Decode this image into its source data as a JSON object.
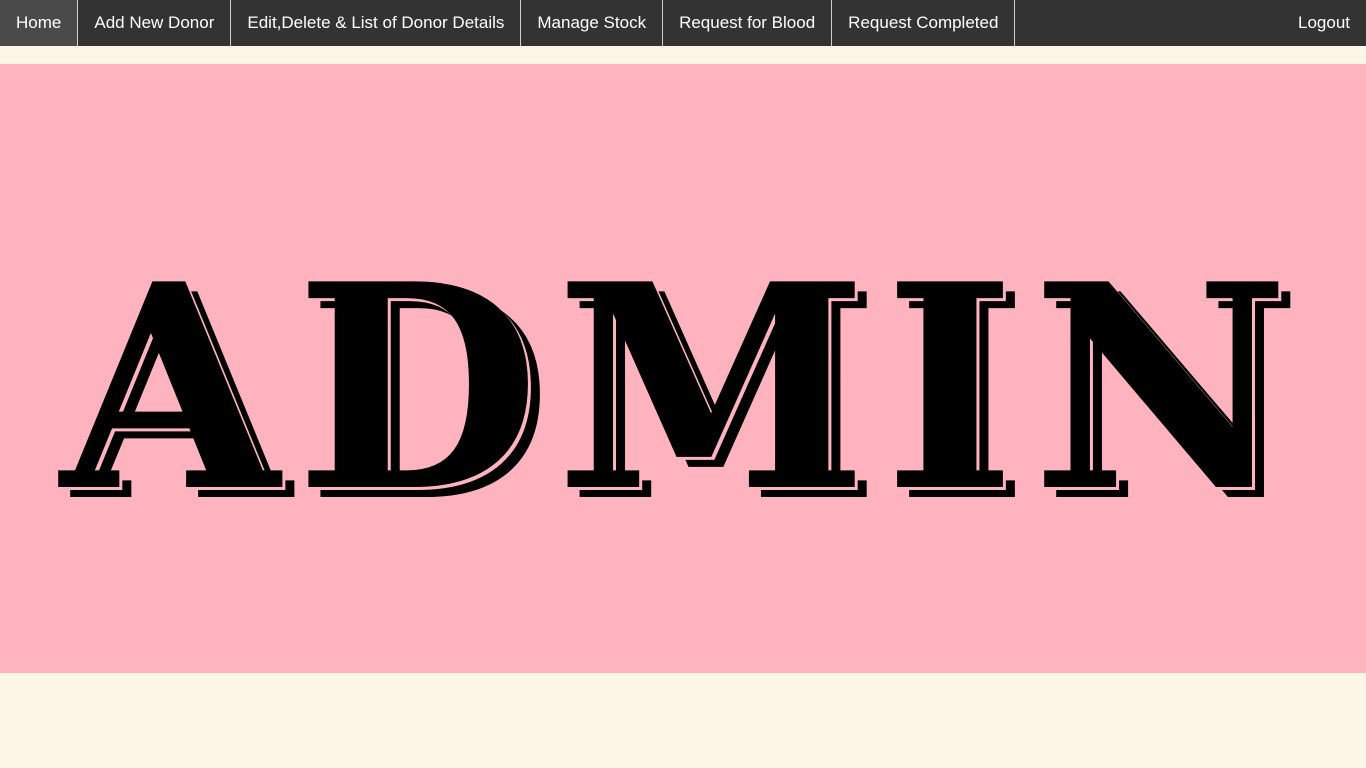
{
  "nav": {
    "items": [
      {
        "label": "Home"
      },
      {
        "label": "Add New Donor"
      },
      {
        "label": "Edit,Delete & List of Donor Details"
      },
      {
        "label": "Manage Stock"
      },
      {
        "label": "Request for Blood"
      },
      {
        "label": "Request Completed"
      }
    ],
    "logout_label": "Logout"
  },
  "banner": {
    "text": "ADMIN"
  },
  "colors": {
    "navbar": "#333333",
    "page_background": "#fdf5e6",
    "banner_background": "#ffb3be",
    "banner_text": "#000000"
  }
}
